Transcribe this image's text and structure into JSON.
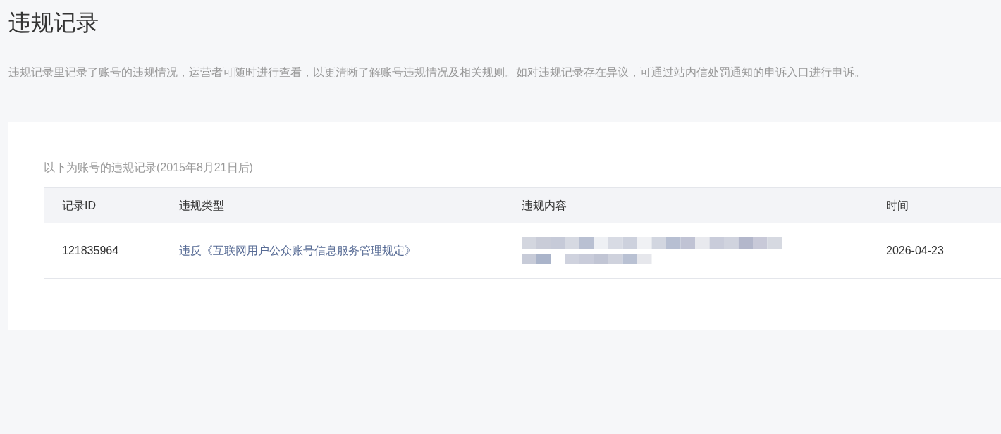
{
  "page": {
    "title": "违规记录",
    "description": "违规记录里记录了账号的违规情况，运营者可随时进行查看，以更清晰了解账号违规情况及相关规则。如对违规记录存在异议，可通过站内信处罚通知的申诉入口进行申诉。"
  },
  "records": {
    "caption": "以下为账号的违规记录(2015年8月21日后)",
    "columns": [
      "记录ID",
      "违规类型",
      "违规内容",
      "时间"
    ],
    "rows": [
      {
        "id": "121835964",
        "type": "违反《互联网用户公众账号信息服务管理规定》",
        "time": "2026-04-23"
      }
    ]
  }
}
